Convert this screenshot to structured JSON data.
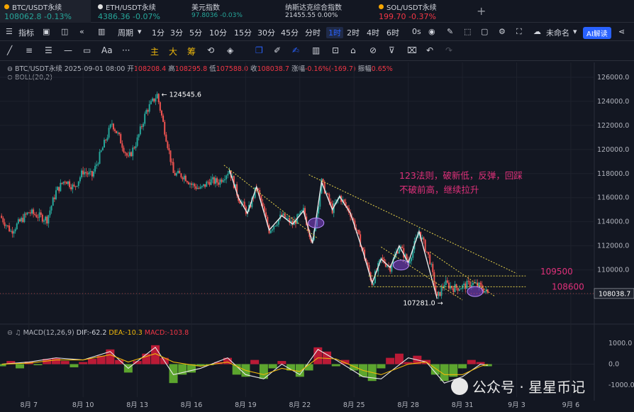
{
  "tickers": [
    {
      "name": "BTC/USDT永续",
      "price": "108062.8",
      "change": "-0.13%",
      "dot": "#f7a600",
      "active": true,
      "priceColor": "#26a69a",
      "changeColor": "#26a69a"
    },
    {
      "name": "ETH/USDT永续",
      "price": "4386.36",
      "change": "-0.07%",
      "dot": "#e0e0e0",
      "active": false,
      "priceColor": "#26a69a",
      "changeColor": "#26a69a"
    },
    {
      "name": "美元指数",
      "price": "97.8036",
      "change": "-0.03%",
      "dot": "",
      "active": false,
      "priceColor": "#26a69a",
      "changeColor": "#26a69a"
    },
    {
      "name": "纳斯达克综合指数",
      "price": "21455.55",
      "change": "0.00%",
      "dot": "",
      "active": false,
      "priceColor": "#d1d4dc",
      "changeColor": "#d1d4dc"
    },
    {
      "name": "SOL/USDT永续",
      "price": "199.70",
      "change": "-0.37%",
      "dot": "#f7a600",
      "active": false,
      "priceColor": "#f23645",
      "changeColor": "#f23645"
    }
  ],
  "toolbar": {
    "indicator_label": "指标",
    "period_label": "周期",
    "intervals": [
      "1分",
      "3分",
      "5分",
      "10分",
      "15分",
      "30分",
      "45分",
      "分时",
      "1时",
      "2时",
      "4时",
      "6时",
      "0s"
    ],
    "selected_interval": "1时",
    "layout_name": "未命名",
    "ai_label": "AI解读"
  },
  "drawing_toolbar": [
    "主",
    "大",
    "筹"
  ],
  "legend": {
    "symbol": "BTC/USDT永续",
    "datetime": "2025-09-01 08:00",
    "open_label": "开",
    "open": "108208.4",
    "high_label": "高",
    "high": "108295.8",
    "low_label": "低",
    "low": "107588.0",
    "close_label": "收",
    "close": "108038.7",
    "change_label": "涨幅",
    "change": "-0.16%(-169.7)",
    "amp_label": "振幅",
    "amp": "0.65%",
    "boll": "BOLL(20,2)"
  },
  "macd_legend": {
    "name": "MACD(12,26,9)",
    "dif": "DIF:-62.2",
    "dea": "DEA:-10.3",
    "macd": "MACD:-103.8"
  },
  "annotation": {
    "line1": "123法则，破新低，反弹，回踩",
    "line2": "不破前高，继续拉升",
    "color": "#e0307a"
  },
  "chart_data": {
    "type": "candlestick",
    "y_ticks": [
      126000,
      124000,
      122000,
      120000,
      118000,
      116000,
      114000,
      112000,
      110000,
      108000
    ],
    "y_tick_labels": [
      "126000.0",
      "124000.0",
      "122000.0",
      "120000.0",
      "118000.0",
      "116000.0",
      "114000.0",
      "112000.0",
      "110000.0",
      "108000.0"
    ],
    "ylim": [
      106500,
      127000
    ],
    "x_tick_labels": [
      "8月 7",
      "8月 10",
      "8月 13",
      "8月 16",
      "8月 19",
      "8月 22",
      "8月 25",
      "8月 28",
      "8月 31",
      "9月 3",
      "9月 6"
    ],
    "x_ticks_day": [
      7,
      10,
      13,
      16,
      19,
      22,
      25,
      28,
      31,
      34,
      37
    ],
    "xlim_day": [
      5.4,
      38.3
    ],
    "path_points": [
      [
        5.4,
        114500
      ],
      [
        6,
        113200
      ],
      [
        7,
        114800
      ],
      [
        8,
        114200
      ],
      [
        8.5,
        116500
      ],
      [
        9,
        117500
      ],
      [
        9.5,
        116800
      ],
      [
        10,
        118200
      ],
      [
        10.5,
        117800
      ],
      [
        11,
        119800
      ],
      [
        11.6,
        122200
      ],
      [
        12,
        121000
      ],
      [
        12.5,
        119200
      ],
      [
        13,
        120800
      ],
      [
        13.5,
        123200
      ],
      [
        14.1,
        124545
      ],
      [
        14.6,
        121000
      ],
      [
        15,
        118000
      ],
      [
        15.6,
        117800
      ],
      [
        16,
        117100
      ],
      [
        16.5,
        116700
      ],
      [
        17,
        117400
      ],
      [
        17.5,
        117300
      ],
      [
        18.1,
        118300
      ],
      [
        18.6,
        116000
      ],
      [
        19.1,
        114700
      ],
      [
        19.6,
        116900
      ],
      [
        20.3,
        113300
      ],
      [
        21.0,
        114500
      ],
      [
        21.6,
        113800
      ],
      [
        22.2,
        114900
      ],
      [
        22.7,
        112200
      ],
      [
        23.2,
        117300
      ],
      [
        23.8,
        115000
      ],
      [
        24.2,
        116100
      ],
      [
        24.8,
        114700
      ],
      [
        25.2,
        113000
      ],
      [
        25.5,
        111500
      ],
      [
        26,
        108900
      ],
      [
        26.5,
        110900
      ],
      [
        27,
        110200
      ],
      [
        27.5,
        112000
      ],
      [
        28,
        110600
      ],
      [
        28.6,
        113200
      ],
      [
        29.2,
        110800
      ],
      [
        29.6,
        107600
      ],
      [
        30.0,
        108900
      ],
      [
        30.5,
        108500
      ],
      [
        31,
        108600
      ],
      [
        31.5,
        108900
      ],
      [
        32.0,
        108600
      ],
      [
        32.4,
        108038
      ]
    ],
    "high_label": "124545.6",
    "low_label": "107281.0",
    "last_price": "108038.7",
    "levels": [
      {
        "value": 109500,
        "label": "109500"
      },
      {
        "value": 108600,
        "label": "108600"
      }
    ],
    "macd_ticks": [
      1000,
      0,
      -1000
    ],
    "macd_tick_labels": [
      "1000.0",
      "0.0",
      "-1000.0"
    ],
    "macd_ylim": [
      -1400,
      1300
    ],
    "macd_hist": [
      [
        5.5,
        -100
      ],
      [
        6,
        150
      ],
      [
        6.5,
        -200
      ],
      [
        7,
        120
      ],
      [
        7.5,
        -50
      ],
      [
        8,
        250
      ],
      [
        8.5,
        300
      ],
      [
        9,
        150
      ],
      [
        9.5,
        -150
      ],
      [
        10,
        100
      ],
      [
        10.5,
        250
      ],
      [
        11,
        400
      ],
      [
        11.5,
        700
      ],
      [
        12,
        200
      ],
      [
        12.5,
        -400
      ],
      [
        13,
        150
      ],
      [
        13.5,
        500
      ],
      [
        14,
        900
      ],
      [
        14.5,
        300
      ],
      [
        15,
        -900
      ],
      [
        15.5,
        -500
      ],
      [
        16,
        -400
      ],
      [
        16.5,
        -100
      ],
      [
        17,
        -50
      ],
      [
        17.5,
        100
      ],
      [
        18,
        300
      ],
      [
        18.5,
        -500
      ],
      [
        19,
        -600
      ],
      [
        19.5,
        200
      ],
      [
        20,
        -700
      ],
      [
        20.5,
        -200
      ],
      [
        21,
        150
      ],
      [
        21.5,
        -300
      ],
      [
        22,
        -600
      ],
      [
        22.5,
        -300
      ],
      [
        23,
        800
      ],
      [
        23.5,
        600
      ],
      [
        24,
        -100
      ],
      [
        24.5,
        200
      ],
      [
        25,
        -300
      ],
      [
        25.5,
        -600
      ],
      [
        26,
        -800
      ],
      [
        26.5,
        -200
      ],
      [
        27,
        300
      ],
      [
        27.5,
        500
      ],
      [
        28,
        100
      ],
      [
        28.5,
        400
      ],
      [
        29,
        200
      ],
      [
        29.5,
        -500
      ],
      [
        30,
        -800
      ],
      [
        30.5,
        -600
      ],
      [
        31,
        -200
      ],
      [
        31.5,
        200
      ],
      [
        32,
        100
      ],
      [
        32.4,
        -100
      ]
    ],
    "dif": [
      [
        5.5,
        0
      ],
      [
        7,
        100
      ],
      [
        8.5,
        300
      ],
      [
        10,
        200
      ],
      [
        11.5,
        600
      ],
      [
        12.5,
        -200
      ],
      [
        14,
        800
      ],
      [
        15,
        -500
      ],
      [
        16.5,
        -200
      ],
      [
        18,
        300
      ],
      [
        19,
        -500
      ],
      [
        20,
        -700
      ],
      [
        21,
        0
      ],
      [
        22,
        -500
      ],
      [
        23,
        700
      ],
      [
        24,
        200
      ],
      [
        25.5,
        -600
      ],
      [
        26.5,
        -700
      ],
      [
        28,
        300
      ],
      [
        29,
        100
      ],
      [
        30,
        -900
      ],
      [
        31,
        -600
      ],
      [
        32,
        0
      ],
      [
        32.4,
        -62
      ]
    ],
    "dea": [
      [
        5.5,
        0
      ],
      [
        7,
        50
      ],
      [
        8.5,
        200
      ],
      [
        10,
        200
      ],
      [
        11.5,
        450
      ],
      [
        12.5,
        100
      ],
      [
        14,
        500
      ],
      [
        15,
        100
      ],
      [
        16.5,
        -100
      ],
      [
        18,
        100
      ],
      [
        19,
        -300
      ],
      [
        20,
        -500
      ],
      [
        21,
        -200
      ],
      [
        22,
        -350
      ],
      [
        23,
        300
      ],
      [
        24,
        250
      ],
      [
        25.5,
        -300
      ],
      [
        26.5,
        -500
      ],
      [
        28,
        0
      ],
      [
        29,
        100
      ],
      [
        30,
        -500
      ],
      [
        31,
        -500
      ],
      [
        32,
        -100
      ],
      [
        32.4,
        -10
      ]
    ]
  },
  "watermark": "公众号 · 星星币记"
}
